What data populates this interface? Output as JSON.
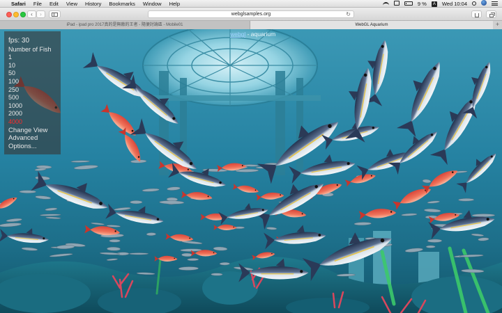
{
  "menubar": {
    "app_name": "Safari",
    "items": [
      "File",
      "Edit",
      "View",
      "History",
      "Bookmarks",
      "Window",
      "Help"
    ],
    "battery": "9 %",
    "clock": "Wed 10:04"
  },
  "toolbar": {
    "back": "‹",
    "forward": "›",
    "url": "webglsamples.org",
    "reload": "↻"
  },
  "tabs": [
    {
      "title": "iPad - ipad pro 2017真的是無敵的王者 - 隨便討論區 - Mobile01"
    },
    {
      "title": "WebGL Aquarium"
    }
  ],
  "new_tab": "+",
  "page": {
    "title_link": "webgl",
    "title_rest": " - aquarium",
    "fps_label": "fps: 30",
    "number_of_fish_label": "Number of Fish",
    "fish_counts": [
      "1",
      "10",
      "50",
      "100",
      "250",
      "500",
      "1000",
      "2000",
      "4000"
    ],
    "selected_count": "4000",
    "change_view": "Change View",
    "advanced": "Advanced",
    "options": "Options..."
  },
  "colors": {
    "water_top": "#2a88a8",
    "water_mid": "#1e6f8c",
    "floor": "#145a6e",
    "selected": "#ff2a2a"
  }
}
